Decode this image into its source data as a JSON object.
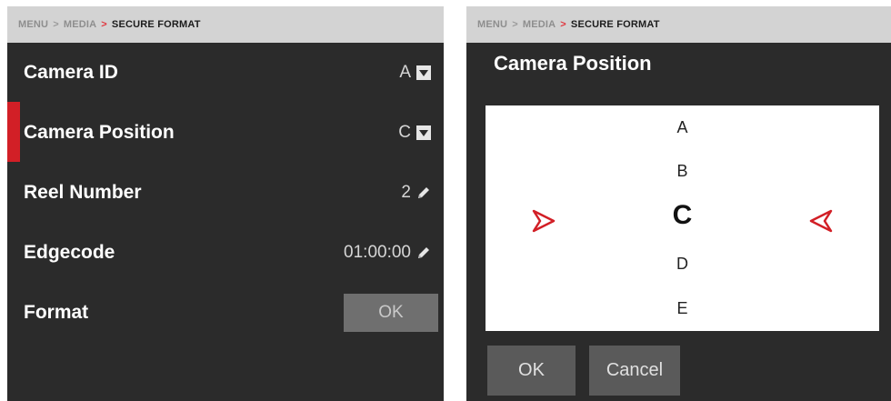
{
  "breadcrumb": {
    "menu": "MENU",
    "media": "MEDIA",
    "current": "SECURE FORMAT",
    "sep": ">"
  },
  "settings": {
    "camera_id": {
      "label": "Camera ID",
      "value": "A"
    },
    "camera_position": {
      "label": "Camera Position",
      "value": "C"
    },
    "reel_number": {
      "label": "Reel Number",
      "value": "2"
    },
    "edgecode": {
      "label": "Edgecode",
      "value": "01:00:00"
    },
    "format": {
      "label": "Format",
      "button": "OK"
    }
  },
  "dialog": {
    "title": "Camera Position",
    "options": [
      "A",
      "B",
      "C",
      "D",
      "E"
    ],
    "selected": "C",
    "ok_label": "OK",
    "cancel_label": "Cancel"
  },
  "colors": {
    "accent": "#d21f26",
    "panel": "#2b2b2b",
    "bar": "#d3d3d3"
  },
  "icons": {
    "dropdown": "chevron-down-icon",
    "edit": "pencil-icon",
    "picker_left": "arrow-right-icon",
    "picker_right": "arrow-left-icon"
  }
}
